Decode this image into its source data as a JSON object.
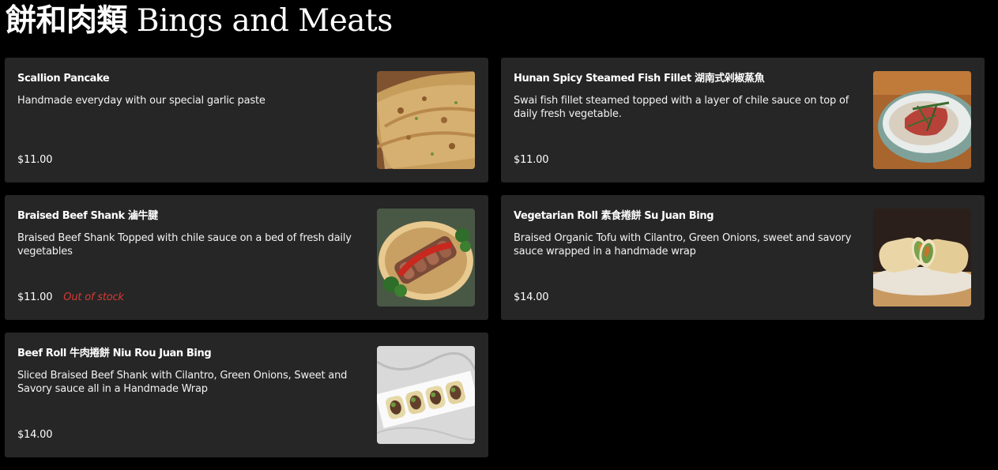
{
  "section": {
    "title_zh": "餅和肉類",
    "title_en": "Bings and Meats"
  },
  "items": [
    {
      "name": "Scallion Pancake",
      "description": "Handmade everyday with our special garlic paste",
      "price": "$11.00",
      "status": "",
      "image": "scallion-pancake-photo"
    },
    {
      "name": "Hunan Spicy Steamed Fish Fillet 湖南式剁椒蒸魚",
      "description": "Swai fish fillet steamed topped with a layer of chile sauce on top of daily fresh vegetable.",
      "price": "$11.00",
      "status": "",
      "image": "steamed-fish-photo"
    },
    {
      "name": "Braised Beef Shank 滷牛腱",
      "description": "Braised Beef Shank Topped with chile sauce on a bed of fresh daily vegetables",
      "price": "$11.00",
      "status": "Out of stock",
      "image": "beef-shank-photo"
    },
    {
      "name": "Vegetarian Roll 素食捲餅 Su Juan Bing",
      "description": "Braised Organic Tofu with Cilantro, Green Onions, sweet and savory sauce wrapped in a handmade wrap",
      "price": "$14.00",
      "status": "",
      "image": "vegetarian-roll-photo"
    },
    {
      "name": "Beef Roll 牛肉捲餅 Niu Rou Juan Bing",
      "description": "Sliced Braised Beef Shank with Cilantro, Green Onions, Sweet and Savory sauce all in a Handmade Wrap",
      "price": "$14.00",
      "status": "",
      "image": "beef-roll-photo"
    }
  ],
  "colors": {
    "page_background": "#000000",
    "card_background": "#262626",
    "out_of_stock": "#d63a32"
  }
}
